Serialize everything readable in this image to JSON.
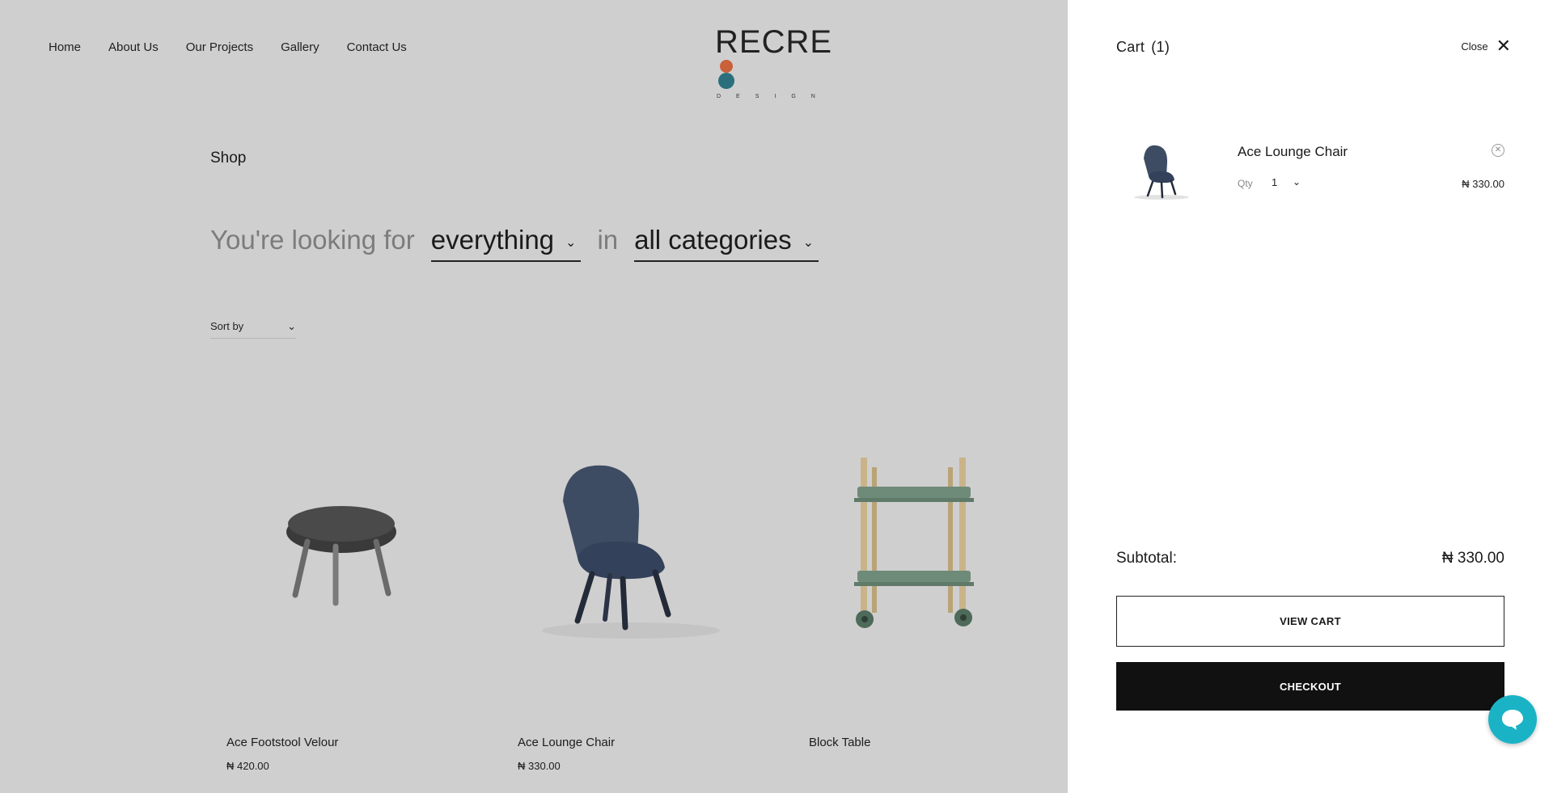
{
  "nav": {
    "items": [
      {
        "label": "Home"
      },
      {
        "label": "About Us"
      },
      {
        "label": "Our Projects"
      },
      {
        "label": "Gallery"
      },
      {
        "label": "Contact Us"
      }
    ]
  },
  "logo": {
    "text_a": "REC",
    "text_b": "RE",
    "sub": "DESIGN"
  },
  "shop": {
    "title": "Shop",
    "filter_prefix": "You're looking for",
    "filter_value": "everything",
    "filter_in": "in",
    "category_value": "all categories",
    "sort_label": "Sort by"
  },
  "products": [
    {
      "name": "Ace Footstool Velour",
      "price": "₦ 420.00"
    },
    {
      "name": "Ace Lounge Chair",
      "price": "₦ 330.00"
    },
    {
      "name": "Block Table",
      "price": ""
    }
  ],
  "cart": {
    "title": "Cart",
    "count": "(1)",
    "close_label": "Close",
    "item": {
      "name": "Ace Lounge Chair",
      "qty_label": "Qty",
      "qty": "1",
      "price": "₦ 330.00"
    },
    "subtotal_label": "Subtotal:",
    "subtotal_value": "₦ 330.00",
    "view_cart_label": "VIEW CART",
    "checkout_label": "CHECKOUT"
  },
  "colors": {
    "overlay_bg": "#cfcfcf",
    "drawer_bg": "#ffffff",
    "checkout_bg": "#111111",
    "chat_bg": "#1ab3c6",
    "logo_teal": "#2b6f7d",
    "logo_orange": "#c9613b"
  }
}
